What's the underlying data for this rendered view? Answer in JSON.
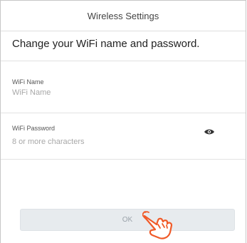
{
  "header": {
    "title": "Wireless Settings"
  },
  "intro": {
    "text": "Change your WiFi name and password."
  },
  "fields": {
    "wifi_name": {
      "label": "WiFi Name",
      "placeholder": "WiFi Name",
      "value": ""
    },
    "wifi_password": {
      "label": "WiFi Password",
      "placeholder": "8 or more characters",
      "value": ""
    }
  },
  "actions": {
    "ok_label": "OK"
  },
  "icons": {
    "password_toggle": "eye-icon",
    "pointer": "hand-pointer-icon"
  },
  "colors": {
    "hand_stroke": "#f05a28",
    "button_bg": "#e7ebee"
  }
}
